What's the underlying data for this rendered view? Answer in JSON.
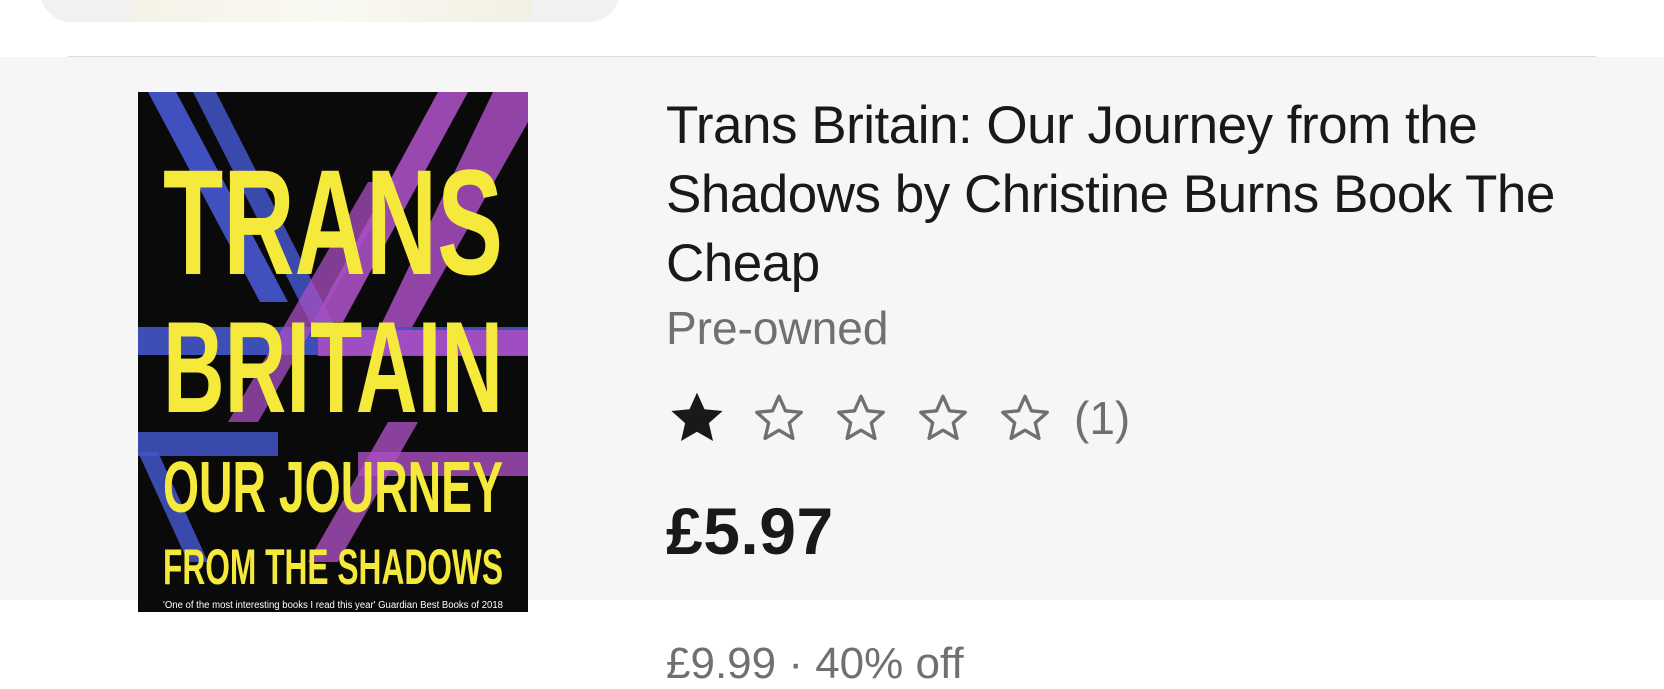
{
  "listing": {
    "title": "Trans Britain: Our Journey from the Shadows by Christine Burns Book The Cheap",
    "condition": "Pre-owned",
    "rating": {
      "filled_stars": 1,
      "total_stars": 5,
      "review_count": "(1)"
    },
    "price": "£5.97",
    "original_price_partial": "£9.99 · 40% off"
  },
  "cover": {
    "line1": "TRANS",
    "line2": "BRITAIN",
    "line3": "OUR JOURNEY",
    "line4": "FROM THE SHADOWS",
    "blurb": "'One of the most interesting books I read this year' Guardian Best Books of 2018"
  },
  "colors": {
    "card_background": "#f6f6f6",
    "text_primary": "#191919",
    "text_secondary": "#707070",
    "cover_background": "#0a0a0a",
    "cover_yellow": "#f5ea3c",
    "cover_blue": "#4355c9",
    "cover_purple": "#a94fc1",
    "star_filled": "#191919",
    "star_empty": "#707070"
  },
  "icons": {
    "filled_star": "star-filled-icon",
    "empty_star": "star-outline-icon"
  }
}
